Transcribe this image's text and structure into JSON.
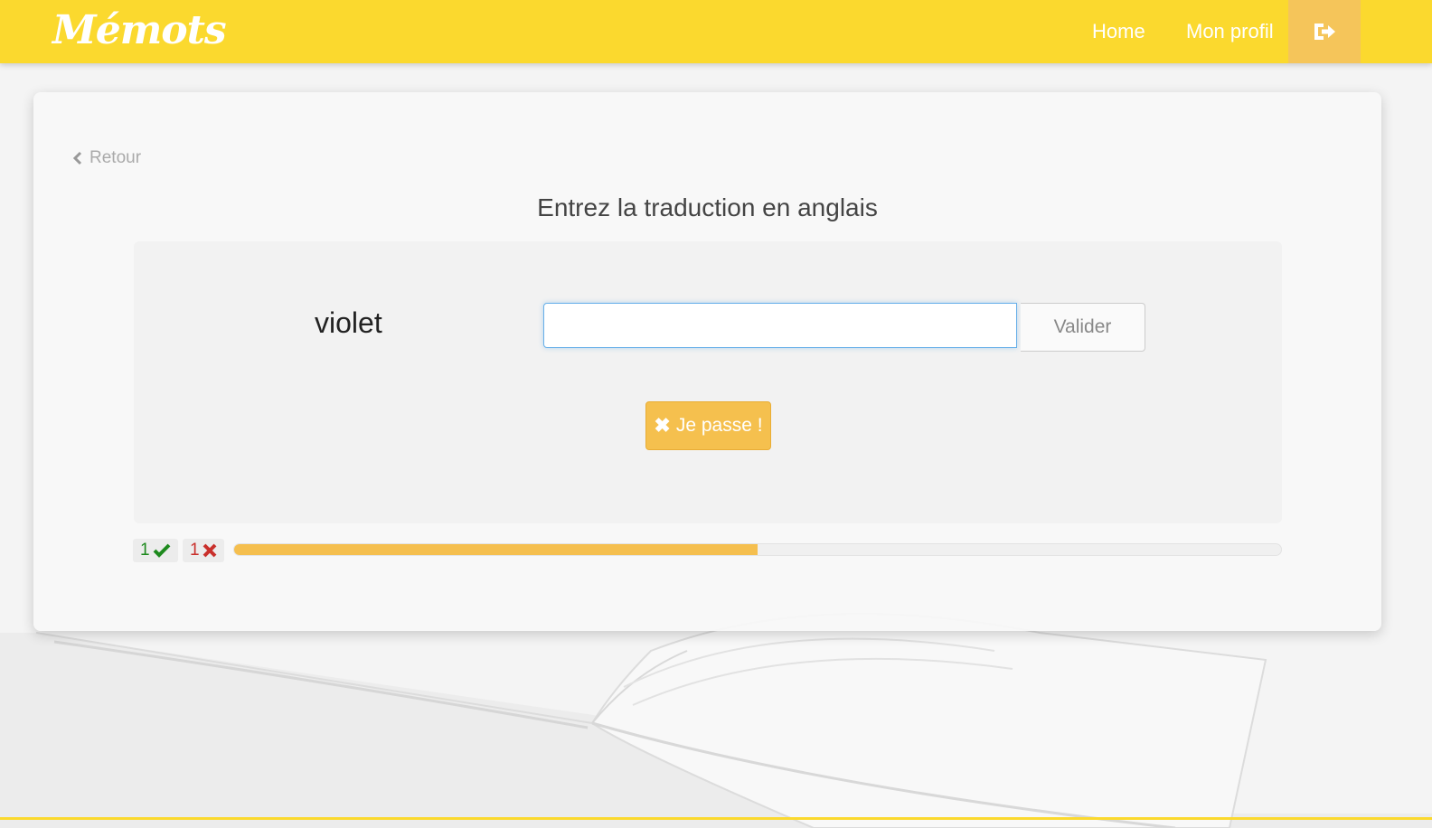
{
  "nav": {
    "brand": "Mémots",
    "links": [
      {
        "label": "Home"
      },
      {
        "label": "Mon profil"
      }
    ],
    "logout_icon": "sign-out-icon"
  },
  "card": {
    "back_label": "Retour",
    "instruction": "Entrez la traduction en anglais",
    "word": "violet",
    "answer_input": {
      "value": "",
      "placeholder": ""
    },
    "validate_label": "Valider",
    "skip_label": "Je passe !",
    "skip_icon": "close-icon"
  },
  "score": {
    "correct": "1",
    "wrong": "1",
    "correct_icon": "check-icon",
    "wrong_icon": "cross-icon"
  },
  "progress": {
    "percent": 50
  },
  "colors": {
    "navbar": "#fbd92e",
    "accent": "#f5c04e",
    "correct": "#1e8a1e",
    "wrong": "#c9302c"
  }
}
